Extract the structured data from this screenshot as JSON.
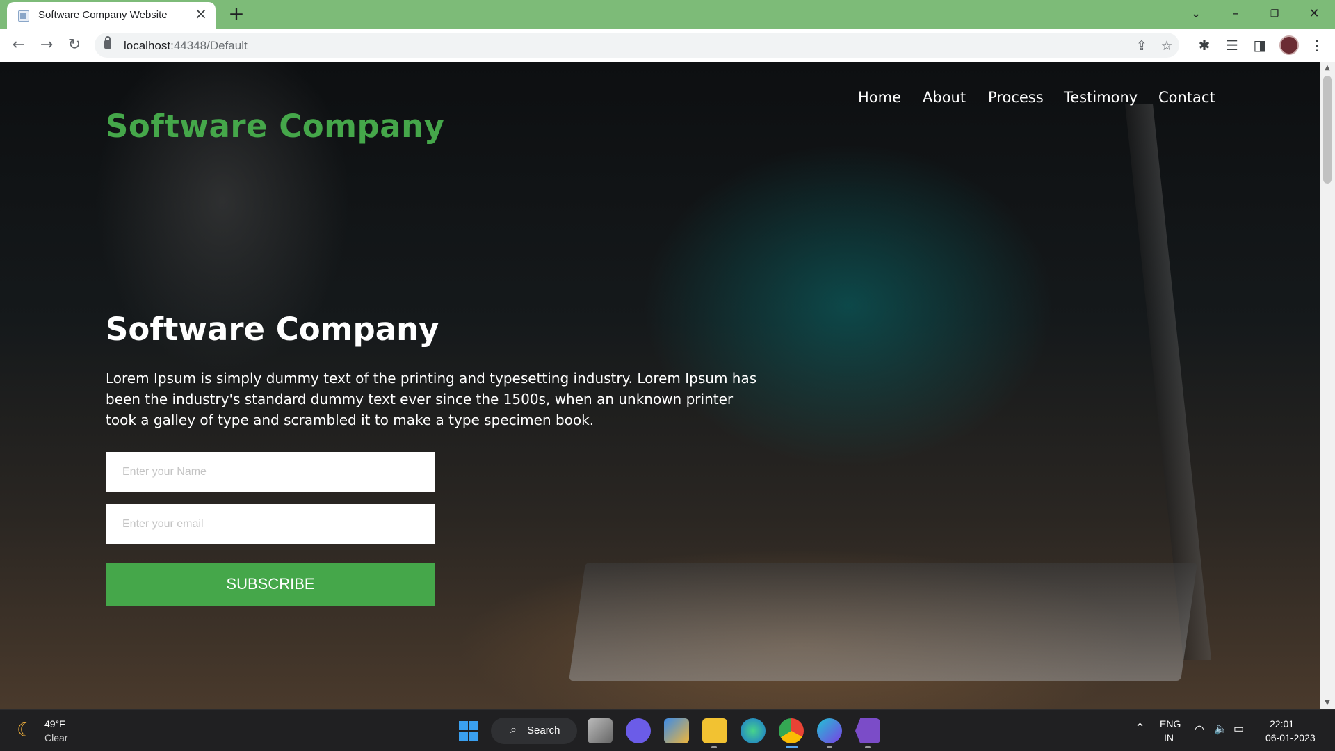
{
  "browser": {
    "tab_title": "Software Company Website",
    "url_host": "localhost",
    "url_rest": ":44348/Default"
  },
  "site": {
    "logo": "Software Company",
    "nav": [
      "Home",
      "About",
      "Process",
      "Testimony",
      "Contact"
    ],
    "hero_title": "Software Company",
    "hero_text": "Lorem Ipsum is simply dummy text of the printing and typesetting industry. Lorem Ipsum has been the industry's standard dummy text ever since the 1500s, when an unknown printer took a galley of type and scrambled it to make a type specimen book.",
    "name_placeholder": "Enter your Name",
    "email_placeholder": "Enter your email",
    "subscribe_label": "SUBSCRIBE",
    "accent_color": "#45a74a"
  },
  "taskbar": {
    "weather_temp": "49°F",
    "weather_cond": "Clear",
    "search_label": "Search",
    "lang": "ENG",
    "region": "IN",
    "time": "22:01",
    "date": "06-01-2023"
  }
}
